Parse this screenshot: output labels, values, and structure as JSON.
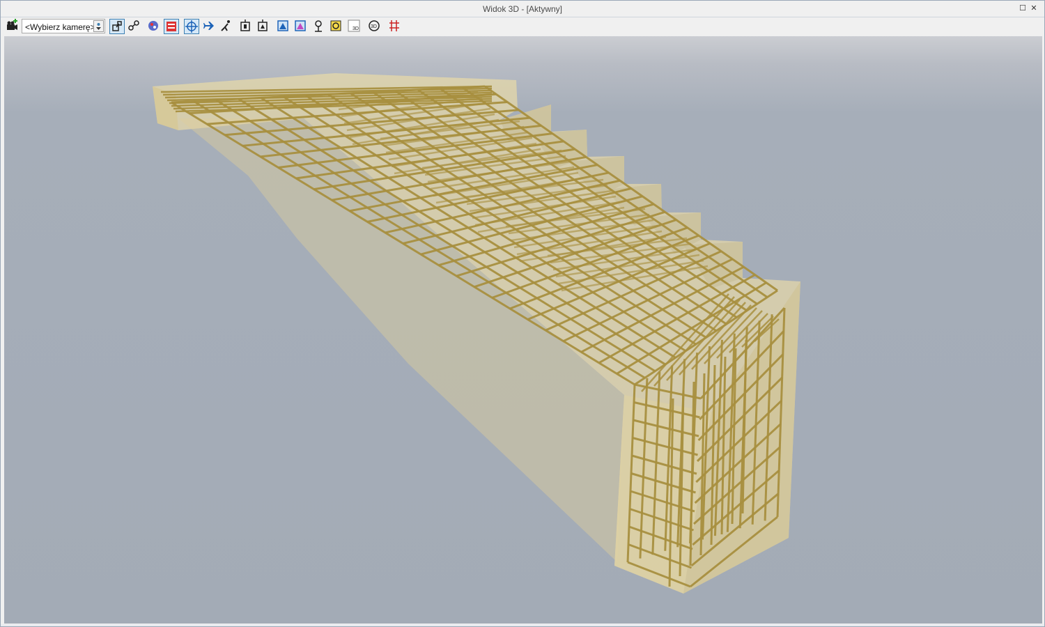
{
  "window": {
    "title": "Widok 3D - [Aktywny]",
    "maximize_glyph": "☐",
    "close_glyph": "✕"
  },
  "toolbar": {
    "camera_select": {
      "value": "<Wybierz kamerę>"
    },
    "tools": [
      {
        "name": "add-camera-icon",
        "active": false
      },
      {
        "name": "camera-dropdown-icon",
        "active": false
      },
      {
        "name": "view-selection-icon",
        "active": true
      },
      {
        "name": "view-link-icon",
        "active": false
      },
      {
        "name": "color-palette-icon",
        "active": false
      },
      {
        "name": "section-icon",
        "active": true
      },
      {
        "name": "orbit-icon",
        "active": true
      },
      {
        "name": "fly-icon",
        "active": false
      },
      {
        "name": "walk-icon",
        "active": false
      },
      {
        "name": "elevation-icon",
        "active": false
      },
      {
        "name": "elevation-alt-icon",
        "active": false
      },
      {
        "name": "fit-view-icon",
        "active": false
      },
      {
        "name": "zoom-window-icon",
        "active": false
      },
      {
        "name": "camera-person-icon",
        "active": false
      },
      {
        "name": "render-icon",
        "active": false
      },
      {
        "name": "view-3d-icon",
        "active": false
      },
      {
        "name": "rotate-3d-icon",
        "active": false
      },
      {
        "name": "grid-cut-icon",
        "active": false
      }
    ]
  },
  "scene": {
    "concrete_color": "#e8d9a8",
    "rebar_color": "#a88f3f",
    "background_top": "#cbcdd2",
    "background_bottom": "#a3abb6"
  }
}
